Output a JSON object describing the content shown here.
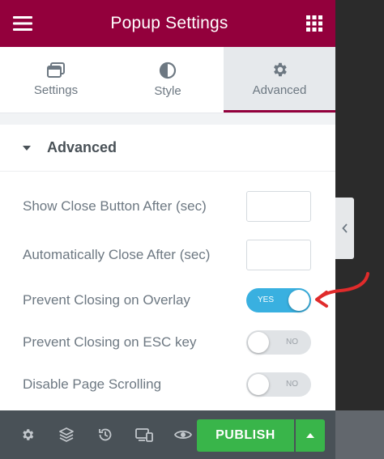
{
  "header": {
    "title": "Popup Settings",
    "menu_icon": "hamburger-icon",
    "apps_icon": "grid-icon"
  },
  "tabs": [
    {
      "label": "Settings",
      "icon": "settings-window-icon",
      "active": false
    },
    {
      "label": "Style",
      "icon": "half-circle-icon",
      "active": false
    },
    {
      "label": "Advanced",
      "icon": "gear-icon",
      "active": true
    }
  ],
  "section": {
    "title": "Advanced"
  },
  "controls": {
    "show_close_after": {
      "label": "Show Close Button After (sec)",
      "value": ""
    },
    "auto_close_after": {
      "label": "Automatically Close After (sec)",
      "value": ""
    },
    "prevent_overlay": {
      "label": "Prevent Closing on Overlay",
      "state": "YES",
      "on": true
    },
    "prevent_esc": {
      "label": "Prevent Closing on ESC key",
      "state": "NO",
      "on": false
    },
    "disable_scroll": {
      "label": "Disable Page Scrolling",
      "state": "NO",
      "on": false
    }
  },
  "footer": {
    "publish_label": "PUBLISH"
  },
  "colors": {
    "brand": "#93003c",
    "toggle_on": "#39b0e0",
    "publish": "#39b54a",
    "footer": "#495157",
    "annotation": "#e02b2b"
  }
}
